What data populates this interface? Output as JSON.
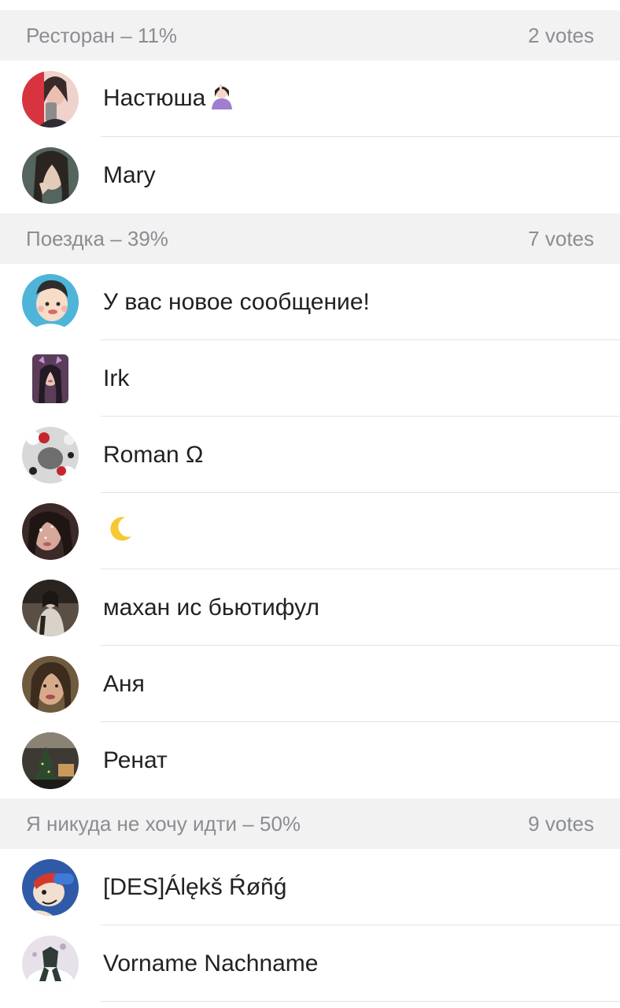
{
  "sections": [
    {
      "title": "Ресторан – 11%",
      "votes": "2 votes",
      "voters": [
        {
          "name": "Настюша",
          "emoji": "woman-gesturing-icon",
          "avatar_colors": [
            "#d8343f",
            "#f2d4cc",
            "#3a2a2a"
          ]
        },
        {
          "name": "Mary",
          "emoji": "",
          "avatar_colors": [
            "#2b3b3a",
            "#e3cbb8",
            "#54645f"
          ]
        }
      ]
    },
    {
      "title": "Поездка – 39%",
      "votes": "7 votes",
      "voters": [
        {
          "name": "У вас новое сообщение!",
          "emoji": "",
          "avatar_colors": [
            "#4eb5d8",
            "#f7dcc7",
            "#2e2e2e"
          ]
        },
        {
          "name": "Irk",
          "emoji": "",
          "avatar_colors": [
            "#5a3d58",
            "#e9c4bd",
            "#231a25"
          ]
        },
        {
          "name": "Roman Ω",
          "emoji": "",
          "avatar_colors": [
            "#d8d8d8",
            "#6e6e6e",
            "#c3262c"
          ]
        },
        {
          "name": "",
          "emoji": "crescent-moon-icon",
          "avatar_colors": [
            "#3b2a27",
            "#d6a79a",
            "#1f1614"
          ]
        },
        {
          "name": "махан ис бьютифул",
          "emoji": "",
          "avatar_colors": [
            "#2a2420",
            "#d9d2c8",
            "#5a4f45"
          ]
        },
        {
          "name": "Аня",
          "emoji": "",
          "avatar_colors": [
            "#6f5a3e",
            "#d8aa8c",
            "#3b2c1e"
          ]
        },
        {
          "name": "Ренат",
          "emoji": "",
          "avatar_colors": [
            "#3d3a34",
            "#c99a5c",
            "#1c1a17"
          ]
        }
      ]
    },
    {
      "title": "Я никуда не хочу идти – 50%",
      "votes": "9 votes",
      "voters": [
        {
          "name": "[DES]Álękš Ŕøñǵ",
          "emoji": "",
          "avatar_colors": [
            "#2f5aa8",
            "#f1e0cf",
            "#d33a2e"
          ]
        },
        {
          "name": "Vorname Nachname",
          "emoji": "",
          "avatar_colors": [
            "#e7e2ea",
            "#2f3b36",
            "#b9a9c3"
          ]
        }
      ]
    }
  ]
}
